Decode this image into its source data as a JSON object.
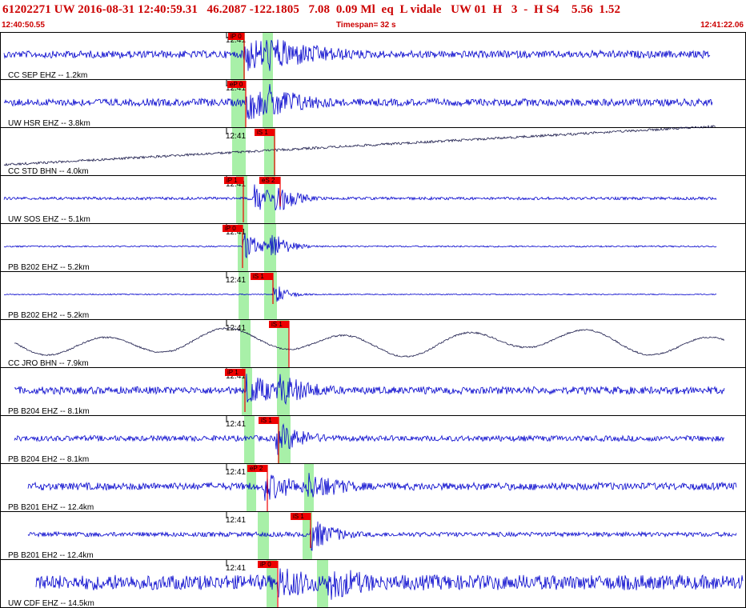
{
  "header": {
    "event_line": "61202271 UW 2016-08-31 12:40:59.31   46.2087 -122.1805   7.08  0.09 Ml  eq  L vidale   UW 01  H   3  -  H S4    5.56  1.52",
    "start_time": "12:40:50.55",
    "timespan": "Timespan=  32 s",
    "end_time": "12:41:22.06"
  },
  "colors": {
    "trace_blue": "#0000cc",
    "trace_dark": "#1a1a4a",
    "pick_red": "#ee0000",
    "window_green": "#a8f0a8",
    "header_red": "#cc0000"
  },
  "channels": [
    {
      "label": "CC SEP EHZ -- 1.2km",
      "tick": "12:41",
      "color": "blue",
      "picks": [
        {
          "label": "iP 0"
        }
      ]
    },
    {
      "label": "UW HSR EHZ -- 3.8km",
      "tick": "12:41",
      "color": "blue",
      "picks": [
        {
          "label": "eP 0"
        }
      ]
    },
    {
      "label": "CC STD BHN -- 4.0km",
      "tick": "12:41",
      "color": "dark",
      "picks": [
        {
          "label": "iS 1"
        }
      ]
    },
    {
      "label": "UW SOS EHZ -- 5.1km",
      "tick": "12:41",
      "color": "blue",
      "picks": [
        {
          "label": "iP 1"
        },
        {
          "label": "eS 2"
        }
      ]
    },
    {
      "label": "PB B202 EHZ -- 5.2km",
      "tick": "12:41",
      "color": "blue",
      "picks": [
        {
          "label": "iP 0"
        }
      ]
    },
    {
      "label": "PB B202 EH2 -- 5.2km",
      "tick": "12:41",
      "color": "blue",
      "picks": [
        {
          "label": "iS 1"
        }
      ]
    },
    {
      "label": "CC JRO BHN -- 7.9km",
      "tick": "12:41",
      "color": "dark",
      "picks": [
        {
          "label": "iS 1"
        }
      ]
    },
    {
      "label": "PB B204 EHZ -- 8.1km",
      "tick": "12:41",
      "color": "blue",
      "picks": [
        {
          "label": "iP 1"
        }
      ]
    },
    {
      "label": "PB B204 EH2 -- 8.1km",
      "tick": "12:41",
      "color": "blue",
      "picks": [
        {
          "label": "iS 1"
        }
      ]
    },
    {
      "label": "PB B201 EHZ -- 12.4km",
      "tick": "12:41",
      "color": "blue",
      "picks": [
        {
          "label": "eP 2"
        }
      ]
    },
    {
      "label": "PB B201 EH2 -- 12.4km",
      "tick": "12:41",
      "color": "blue",
      "picks": [
        {
          "label": "iS 1"
        }
      ]
    },
    {
      "label": "UW CDF EHZ -- 14.5km",
      "tick": "12:41",
      "color": "blue",
      "picks": [
        {
          "label": "iP 0"
        }
      ]
    }
  ]
}
